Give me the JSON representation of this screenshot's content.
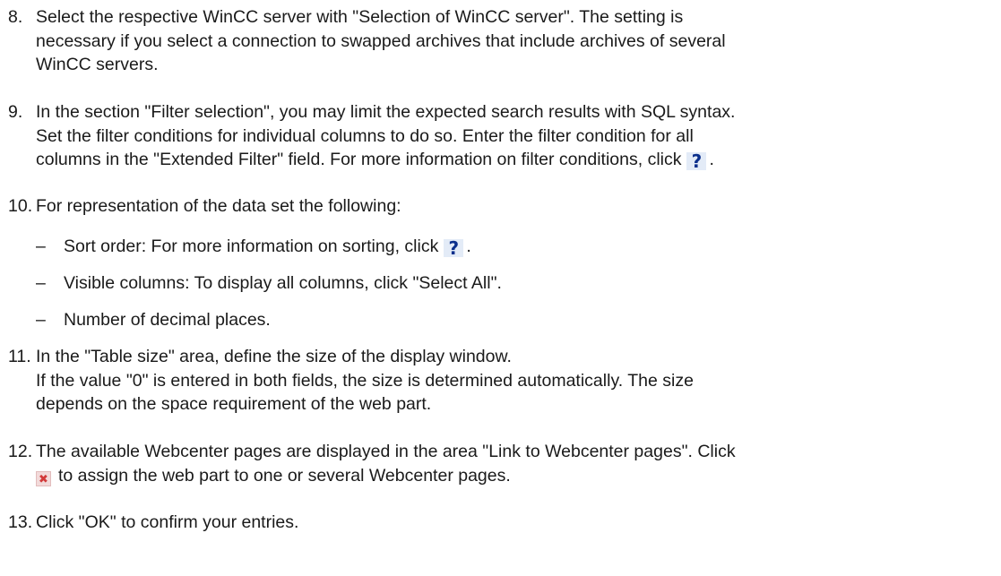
{
  "steps": [
    {
      "number": "8.",
      "lines": [
        "Select the respective WinCC server with \"Selection of WinCC server\". The setting is",
        "necessary if you select a connection to swapped archives that include archives of several",
        "WinCC servers."
      ]
    },
    {
      "number": "9.",
      "lines": [
        "In the section \"Filter selection\", you may limit the expected search results with SQL syntax.",
        "Set the filter conditions for individual columns to do so. Enter the filter condition for all"
      ],
      "last_line_before_icon": "columns in the \"Extended Filter\" field. For more information on filter conditions, click",
      "last_line_after_icon": "."
    },
    {
      "number": "10.",
      "lines": [
        "For representation of the data set the following:"
      ],
      "subitems": [
        {
          "dash": "–",
          "before_icon": "Sort order: For more information on sorting, click",
          "after_icon": "."
        },
        {
          "dash": "–",
          "text": "Visible columns: To display all columns, click \"Select All\"."
        },
        {
          "dash": "–",
          "text": "Number of decimal places."
        }
      ]
    },
    {
      "number": "11.",
      "lines": [
        "In the \"Table size\" area, define the size of the display window.",
        "If the value \"0\" is entered in both fields, the size is determined automatically. The size",
        "depends on the space requirement of the web part."
      ]
    },
    {
      "number": "12.",
      "lines": [
        "The available Webcenter pages are displayed in the area \"Link to Webcenter pages\". Click"
      ],
      "last_line_after_icon": "to assign the web part to one or several Webcenter pages."
    },
    {
      "number": "13.",
      "lines": [
        "Click \"OK\" to confirm your entries."
      ]
    }
  ],
  "icons": {
    "help": "?",
    "remove": "✖"
  }
}
